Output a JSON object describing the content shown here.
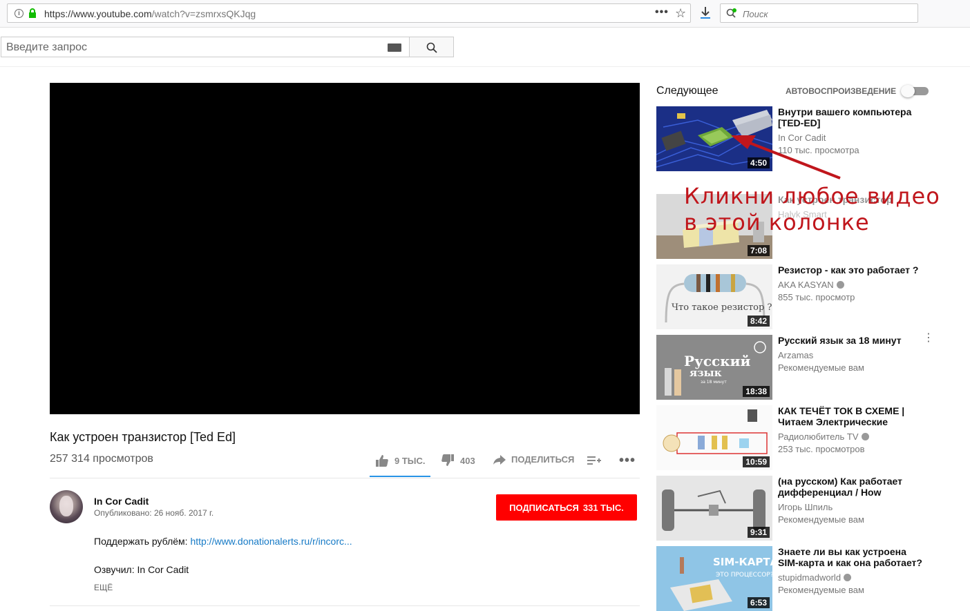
{
  "browser": {
    "url_host": "https://www.youtube.com",
    "url_path": "/watch?v=zsmrxsQKJqg",
    "more_glyph": "•••",
    "star_glyph": "☆",
    "search_placeholder": "Поиск"
  },
  "yt": {
    "search_placeholder": "Введите запрос"
  },
  "video": {
    "title": "Как устроен транзистор [Ted Ed]",
    "views": "257 314 просмотров",
    "likes": "9 ТЫС.",
    "dislikes": "403",
    "share_label": "ПОДЕЛИТЬСЯ",
    "more_glyph": "•••"
  },
  "channel": {
    "name": "In Cor Cadit",
    "published": "Опубликовано: 26 нояб. 2017 г.",
    "subscribe_label": "ПОДПИСАТЬСЯ",
    "subscribe_count": "331 ТЫС."
  },
  "description": {
    "support_text": "Поддержать рублём: ",
    "support_link": "http://www.donationalerts.ru/r/incorc...",
    "voiced": "Озвучил: In Cor Cadit",
    "more_label": "ЕЩЁ"
  },
  "sidebar": {
    "up_next": "Следующее",
    "autoplay": "АВТОВОСПРОИЗВЕДЕНИЕ",
    "items": [
      {
        "title": "Внутри вашего компьютера [TED-ED]",
        "channel": "In Cor Cadit",
        "meta": "110 тыс. просмотра",
        "duration": "4:50"
      },
      {
        "title": "Как устроен транзистор",
        "channel": "Halyk Smart",
        "meta": "",
        "duration": "7:08"
      },
      {
        "title": "Резистор - как это работает ?",
        "channel": "AKA KASYAN",
        "meta": "855 тыс. просмотр",
        "duration": "8:42"
      },
      {
        "title": "Русский язык за 18 минут",
        "channel": "Arzamas",
        "meta": "Рекомендуемые вам",
        "duration": "18:38"
      },
      {
        "title": "КАК ТЕЧЁТ ТОК В СХЕМЕ | Читаем Электрические",
        "channel": "Радиолюбитель TV",
        "meta": "253 тыс. просмотров",
        "duration": "10:59"
      },
      {
        "title": "(на русском) Как работает дифференциал / How",
        "channel": "Игорь Шпиль",
        "meta": "Рекомендуемые вам",
        "duration": "9:31"
      },
      {
        "title": "Знаете ли вы как устроена SIM-карта и как она работает?",
        "channel": "stupidmadworld",
        "meta": "Рекомендуемые вам",
        "duration": "6:53"
      }
    ],
    "thumb_texts": {
      "resistor": "Что такое резистор ?",
      "russian_1": "Русский",
      "russian_2": "язык",
      "russian_3": "за 18 минут",
      "sim_1": "SIM-КАРТА",
      "sim_2": "ЭТО ПРОЦЕССОР?"
    }
  },
  "annotation": {
    "line1": "Кликни любое видео",
    "line2": "в этой колонке"
  }
}
